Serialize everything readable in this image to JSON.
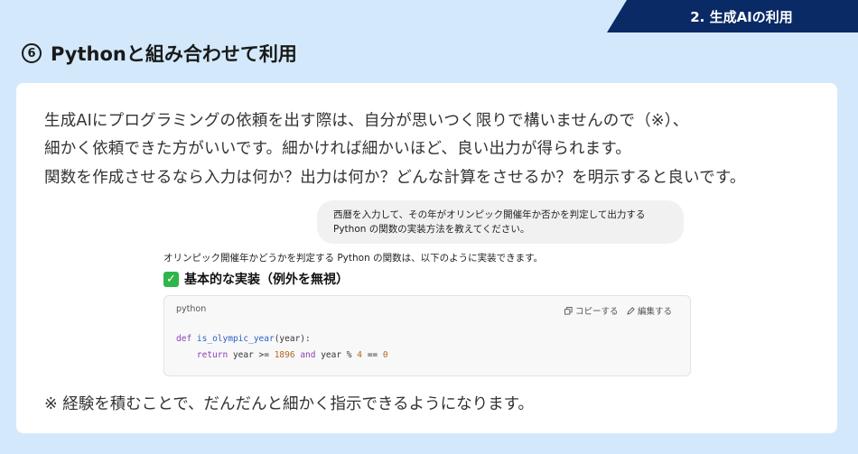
{
  "section_tab": "2. 生成AIの利用",
  "title": {
    "number": "6",
    "text": "Pythonと組み合わせて利用"
  },
  "body_lines": [
    "生成AIにプログラミングの依頼を出す際は、自分が思いつく限りで構いませんので（※）、",
    "細かく依頼できた方がいいです。細かければ細かいほど、良い出力が得られます。",
    "関数を作成させるなら入力は何か？出力は何か？どんな計算をさせるか？を明示すると良いです。"
  ],
  "chat": {
    "user_message_line1": "西暦を入力して、その年がオリンピック開催年か否かを判定して出力する",
    "user_message_line2": "Python の関数の実装方法を教えてください。",
    "response_intro": "オリンピック開催年かどうかを判定する Python の関数は、以下のように実装できます。",
    "heading": "基本的な実装（例外を無視）",
    "code": {
      "language": "python",
      "copy_label": "コピーする",
      "edit_label": "編集する",
      "line1": {
        "kw": "def",
        "fn": "is_olympic_year",
        "rest": "(year):"
      },
      "line2": {
        "kw1": "return",
        "t1": " year >= ",
        "n1": "1896",
        "kw2": " and",
        "t2": " year % ",
        "n2": "4",
        "t3": " == ",
        "n3": "0"
      }
    }
  },
  "note": "※ 経験を積むことで、だんだんと細かく指示できるようになります。",
  "colors": {
    "background": "#d3e9fb",
    "tab": "#0a2a66",
    "card": "#ffffff",
    "keyword": "#8a3fb5",
    "function": "#2b61c5",
    "number": "#b5651d",
    "check": "#2fb54a"
  }
}
